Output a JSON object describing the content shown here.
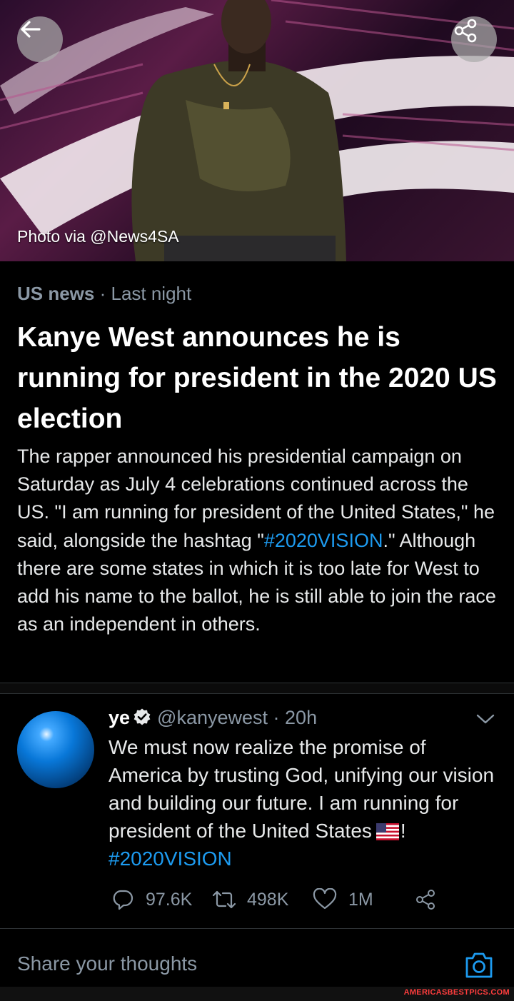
{
  "hero": {
    "photo_credit": "Photo via @News4SA"
  },
  "article": {
    "category": "US news",
    "separator": " · ",
    "time": "Last night",
    "headline": "Kanye West announces he is running for president in the 2020 US election",
    "summary_part1": "The rapper announced his presidential campaign on Saturday as July 4 celebrations continued across the US. \"I am running for president of the United States,\" he said, alongside the hashtag \"",
    "summary_hashtag": "#2020VISION",
    "summary_part2": ".\" Although there are some states in which it is too late for West to add his name to the ballot, he is still able to join the race as an independent in others."
  },
  "tweet": {
    "name": "ye",
    "handle": "@kanyewest",
    "separator": " · ",
    "time": "20h",
    "text_part1": "We must now realize the promise of America by trusting God, unifying our vision and building our future. I am running for president of the United States",
    "text_after_flag": "! ",
    "hashtag": "#2020VISION",
    "replies": "97.6K",
    "retweets": "498K",
    "likes": "1M"
  },
  "compose": {
    "placeholder": "Share your thoughts"
  },
  "watermark": "AMERICASBESTPICS.COM",
  "colors": {
    "link": "#1d9bf0",
    "muted": "#8b98a5",
    "background": "#000000"
  }
}
